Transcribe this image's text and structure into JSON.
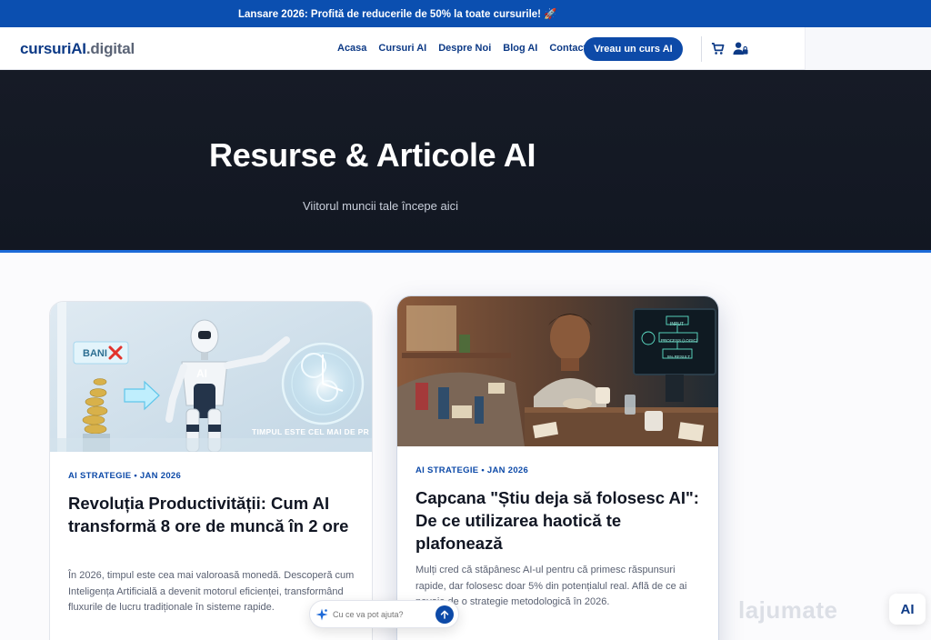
{
  "promo": {
    "text": "Lansare 2026: Profită de reducerile de 50% la toate cursurile! 🚀"
  },
  "brand": {
    "name_part1": "cursuriAI",
    "name_part2": ".digital"
  },
  "nav": {
    "items": [
      "Acasa",
      "Cursuri AI",
      "Despre Noi",
      "Blog AI",
      "Contact"
    ],
    "cta": "Vreau un curs AI",
    "icons": [
      "cart-icon",
      "user-icon"
    ]
  },
  "hero": {
    "title": "Resurse & Articole AI",
    "subtitle": "Viitorul muncii tale începe aici"
  },
  "articles": [
    {
      "image_label_bani": "BANI",
      "image_label_ai": "AI",
      "image_caption": "TIMPUL ESTE CEL MAI DE PR",
      "meta": "AI STRATEGIE • JAN 2026",
      "title": "Revoluția Productivității: Cum AI transformă 8 ore de muncă în 2 ore",
      "excerpt": "În 2026, timpul este cea mai valoroasă monedă. Descoperă cum Inteligența Artificială a devenit motorul eficienței, transformând fluxurile de lucru tradiționale în sisteme rapide."
    },
    {
      "image_screen_text": [
        "INPUT",
        "PROCESS (LOGIC)",
        "5% RESULT"
      ],
      "meta": "AI STRATEGIE • JAN 2026",
      "title": "Capcana \"Știu deja să folosesc AI\": De ce utilizarea haotică te plafonează",
      "excerpt": "Mulți cred că stăpânesc AI-ul pentru că primesc răspunsuri rapide, dar folosesc doar 5% din potențialul real. Află de ce ai nevoie de o strategie metodologică în 2026."
    }
  ],
  "chat": {
    "placeholder": "Cu ce va pot ajuta?"
  },
  "watermark": {
    "text": "lajumate",
    "badge": "AI"
  },
  "colors": {
    "primary": "#0d4aa8",
    "promo_bg": "#0b4fb0",
    "hero_bg": "#151a25",
    "accent_line": "#1d6ad8"
  }
}
